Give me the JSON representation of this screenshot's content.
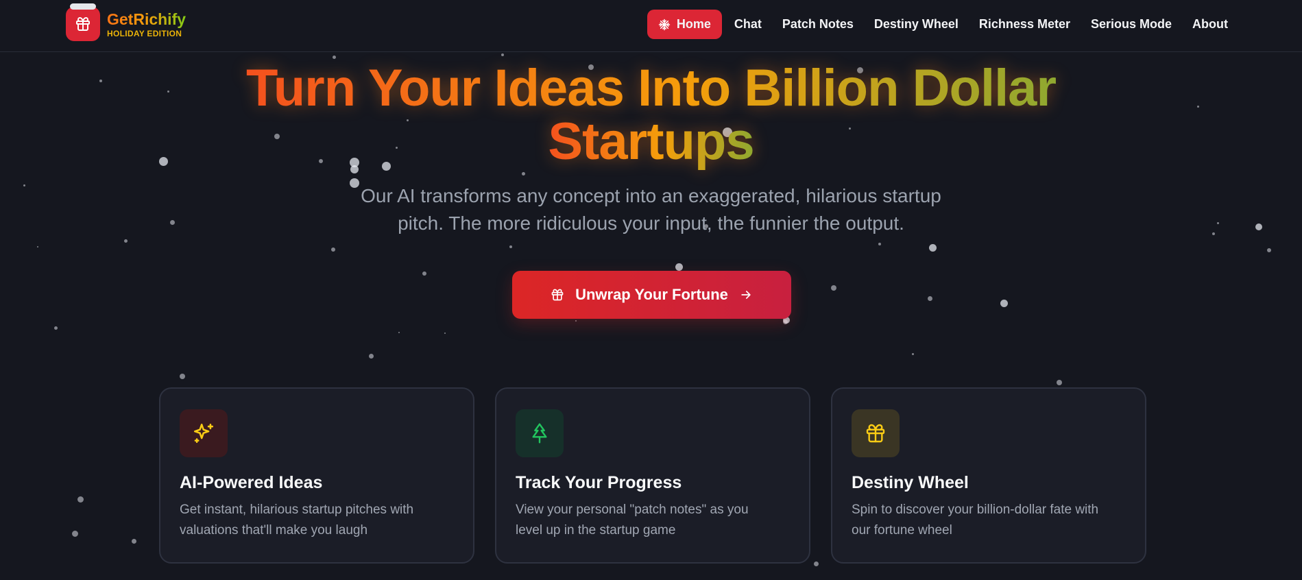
{
  "brand": {
    "name": "GetRichify",
    "edition": "HOLIDAY EDITION",
    "icon": "gift-icon"
  },
  "nav": {
    "items": [
      {
        "label": "Home",
        "icon": "snowflake-icon",
        "active": true
      },
      {
        "label": "Chat"
      },
      {
        "label": "Patch Notes"
      },
      {
        "label": "Destiny Wheel"
      },
      {
        "label": "Richness Meter"
      },
      {
        "label": "Serious Mode"
      },
      {
        "label": "About"
      }
    ]
  },
  "hero": {
    "title_line1": "Turn Your Ideas Into Billion Dollar",
    "title_line2": "Startups",
    "subtitle_line1": "Our AI transforms any concept into an exaggerated, hilarious startup",
    "subtitle_line2": "pitch. The more ridiculous your input, the funnier the output.",
    "cta_label": "Unwrap Your Fortune",
    "cta_icons": [
      "gift-icon",
      "arrow-right-icon"
    ]
  },
  "features": [
    {
      "title": "AI-Powered Ideas",
      "desc_line1": "Get instant, hilarious startup pitches with",
      "desc_line2": "valuations that'll make you laugh",
      "icon": "sparkles-icon",
      "icon_color": "#facc15",
      "icon_bg": "#3a1a1f"
    },
    {
      "title": "Track Your Progress",
      "desc_line1": "View your personal \"patch notes\" as you",
      "desc_line2": "level up in the startup game",
      "icon": "tree-icon",
      "icon_color": "#22c55e",
      "icon_bg": "#16302a"
    },
    {
      "title": "Destiny Wheel",
      "desc_line1": "Spin to discover your billion-dollar fate with",
      "desc_line2": "our fortune wheel",
      "icon": "gift-icon",
      "icon_color": "#facc15",
      "icon_bg": "#3a3524"
    }
  ],
  "colors": {
    "background": "#15171f",
    "accent_red": "#dc2635",
    "title_gradient": [
      "#f4511e",
      "#f59e0b",
      "#8fa830"
    ]
  }
}
